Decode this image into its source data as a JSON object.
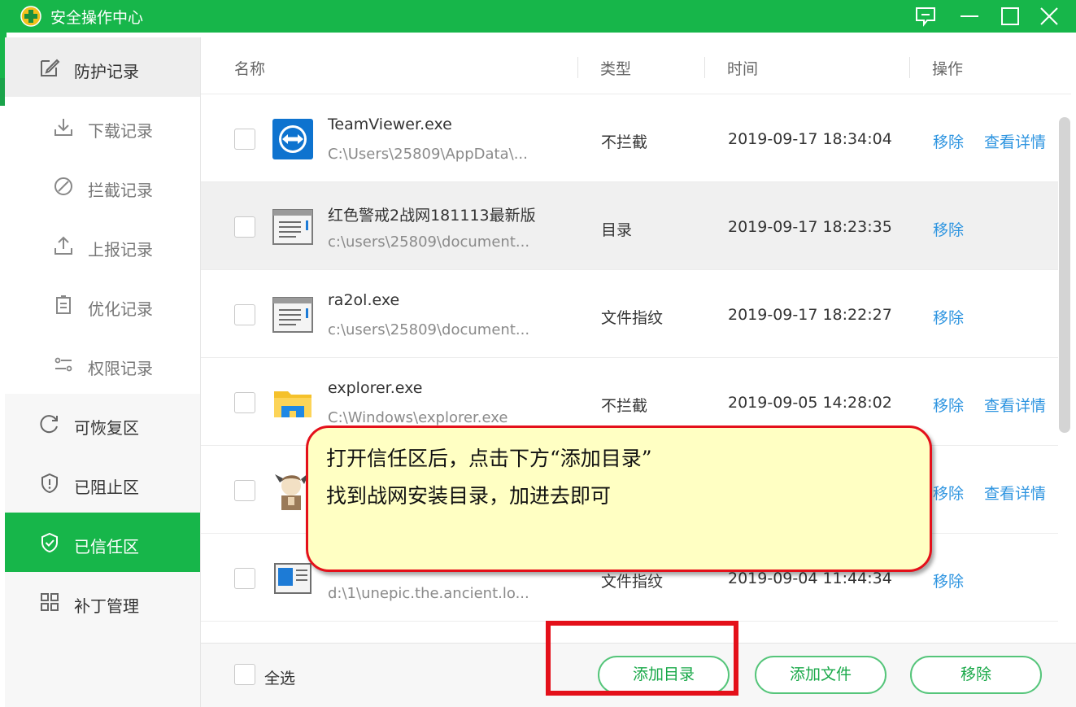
{
  "window": {
    "title": "安全操作中心",
    "accent_color": "#17b64a",
    "controls": [
      "feedback-icon",
      "minimize-icon",
      "maximize-icon",
      "close-icon"
    ]
  },
  "sidebar": {
    "items": [
      {
        "label": "防护记录",
        "icon": "edit-icon"
      },
      {
        "label": "下载记录",
        "icon": "download-icon"
      },
      {
        "label": "拦截记录",
        "icon": "block-icon"
      },
      {
        "label": "上报记录",
        "icon": "upload-icon"
      },
      {
        "label": "优化记录",
        "icon": "clipboard-icon"
      },
      {
        "label": "权限记录",
        "icon": "settings-toggle-icon"
      },
      {
        "label": "可恢复区",
        "icon": "restore-icon"
      },
      {
        "label": "已阻止区",
        "icon": "shield-alert-icon"
      },
      {
        "label": "已信任区",
        "icon": "shield-check-icon",
        "active": true
      },
      {
        "label": "补丁管理",
        "icon": "grid-icon"
      }
    ]
  },
  "table": {
    "headers": {
      "name": "名称",
      "type": "类型",
      "time": "时间",
      "action": "操作"
    },
    "rows": [
      {
        "name": "TeamViewer.exe",
        "path": "C:\\Users\\25809\\AppData\\...",
        "type": "不拦截",
        "time": "2019-09-17 18:34:04",
        "remove": "移除",
        "detail": "查看详情",
        "icon": "teamviewer-icon"
      },
      {
        "name": "红色警戒2战网181113最新版",
        "path": "c:\\users\\25809\\document...",
        "type": "目录",
        "time": "2019-09-17 18:23:35",
        "remove": "移除",
        "icon": "folder-window-icon"
      },
      {
        "name": "ra2ol.exe",
        "path": "c:\\users\\25809\\document...",
        "type": "文件指纹",
        "time": "2019-09-17 18:22:27",
        "remove": "移除",
        "icon": "app-window-icon"
      },
      {
        "name": "explorer.exe",
        "path": "C:\\Windows\\explorer.exe",
        "type": "不拦截",
        "time": "2019-09-05 14:28:02",
        "remove": "移除",
        "detail": "查看详情",
        "icon": "explorer-folder-icon"
      },
      {
        "remove": "移除",
        "detail": "查看详情",
        "icon": "game-character-icon"
      },
      {
        "path": "d:\\1\\unepic.the.ancient.lo...",
        "type": "文件指纹",
        "time": "2019-09-04 11:44:34",
        "remove": "移除",
        "icon": "document-icon"
      }
    ]
  },
  "footer": {
    "select_all": "全选",
    "add_directory": "添加目录",
    "add_file": "添加文件",
    "remove": "移除"
  },
  "annotation": {
    "line1": "打开信任区后，点击下方“添加目录”",
    "line2": "找到战网安装目录，加进去即可",
    "color": "#e4101a"
  }
}
